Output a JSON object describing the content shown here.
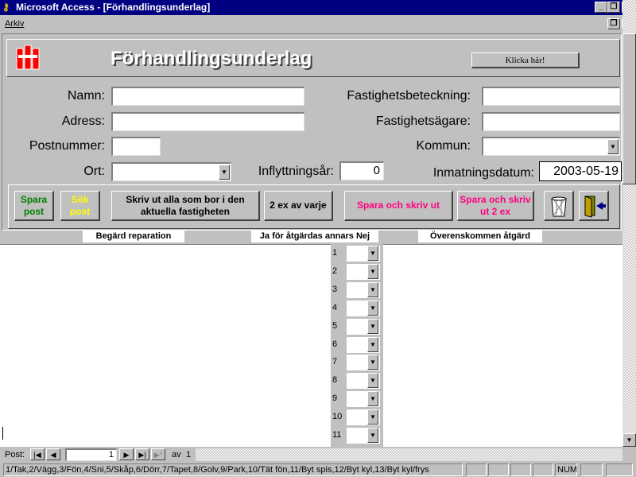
{
  "window": {
    "title": "Microsoft Access - [Förhandlingsunderlag]"
  },
  "menu": {
    "items": [
      "Arkiv"
    ]
  },
  "header": {
    "title": "Förhandlingsunderlag",
    "click_button": "Klicka här!"
  },
  "fields": {
    "namn": {
      "label": "Namn:",
      "value": ""
    },
    "adress": {
      "label": "Adress:",
      "value": ""
    },
    "postnummer": {
      "label": "Postnummer:",
      "value": ""
    },
    "ort": {
      "label": "Ort:",
      "value": ""
    },
    "fastighetsbeteckning": {
      "label": "Fastighetsbeteckning:",
      "value": ""
    },
    "fastighetsagare": {
      "label": "Fastighetsägare:",
      "value": ""
    },
    "kommun": {
      "label": "Kommun:",
      "value": ""
    },
    "inflyttningsar": {
      "label": "Inflyttningsår:",
      "value": "0"
    },
    "inmatningsdatum": {
      "label": "Inmatningsdatum:",
      "value": "2003-05-19"
    }
  },
  "buttons": {
    "spara_post": "Spara post",
    "sok_post": "Sök post",
    "skriv_ut_alla": "Skriv ut alla som bor i den aktuella fastigheten",
    "tva_ex": "2 ex av varje",
    "spara_skriv": "Spara och skriv ut",
    "spara_skriv_2": "Spara och skriv ut 2 ex"
  },
  "columns": {
    "begard": "Begärd reparation",
    "ja_nej": "Ja för åtgärdas annars Nej",
    "overens": "Överenskommen åtgärd"
  },
  "rows": [
    "1",
    "2",
    "3",
    "4",
    "5",
    "6",
    "7",
    "8",
    "9",
    "10",
    "11"
  ],
  "nav": {
    "label": "Post:",
    "current": "1",
    "of_label": "av",
    "total": "1"
  },
  "status": {
    "legend": "1/Tak,2/Vägg,3/Fön,4/Sni,5/Skåp,6/Dörr,7/Tapet,8/Golv,9/Park,10/Tät fön,11/Byt spis,12/Byt kyl,13/Byt kyl/frys",
    "num": "NUM"
  },
  "colors": {
    "titlebar": "#000080",
    "green": "#008000",
    "yellow": "#ffff00",
    "magenta": "#ff0080",
    "logo": "#ff0000"
  }
}
